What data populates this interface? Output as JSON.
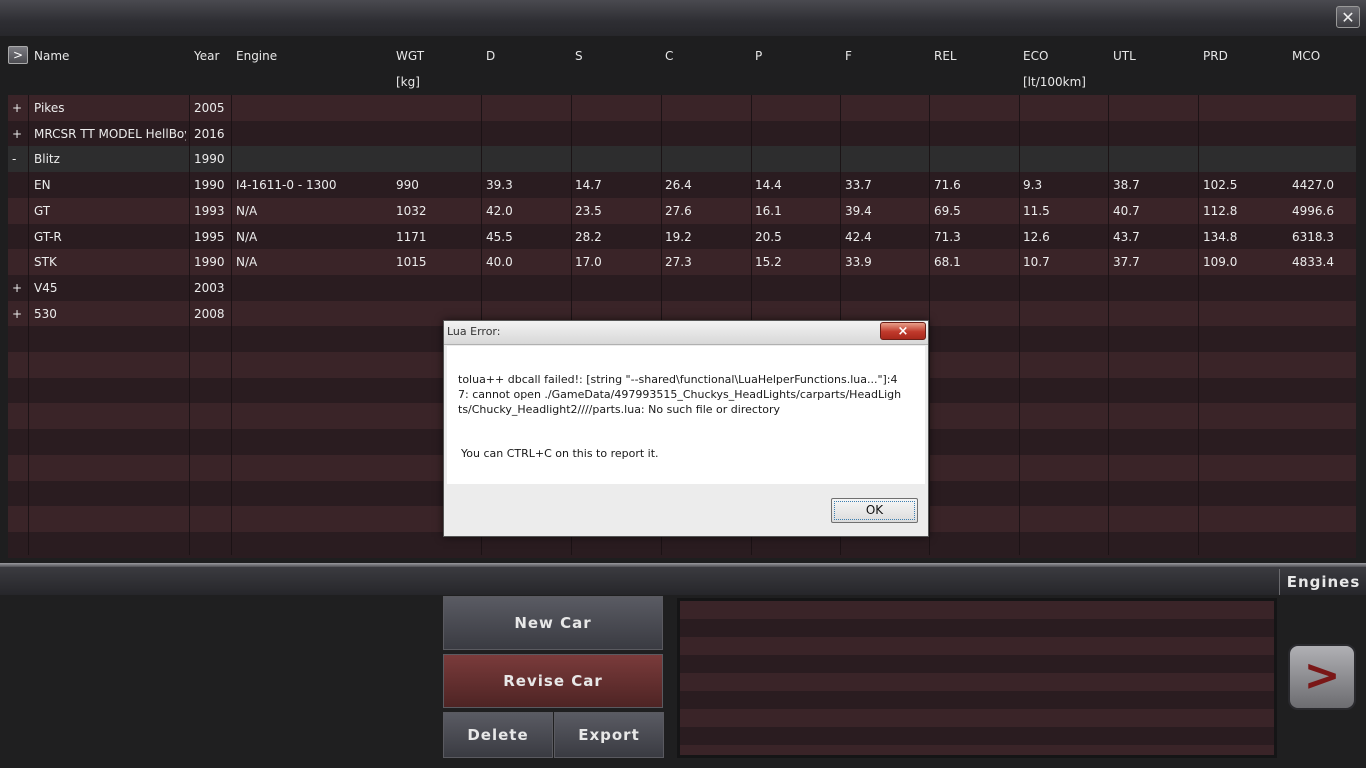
{
  "window": {
    "close_icon": "close-icon"
  },
  "table": {
    "expand_label": ">",
    "headers": [
      "Name",
      "Year",
      "Engine",
      "WGT",
      "D",
      "S",
      "C",
      "P",
      "F",
      "REL",
      "ECO",
      "UTL",
      "PRD",
      "MCO"
    ],
    "units": {
      "wgt": "[kg]",
      "eco": "[lt/100km]"
    },
    "rows": [
      {
        "toggle": "+",
        "name": "Pikes",
        "year": "2005",
        "engine": "",
        "wgt": "",
        "d": "",
        "s": "",
        "c": "",
        "p": "",
        "f": "",
        "rel": "",
        "eco": "",
        "utl": "",
        "prd": "",
        "mco": ""
      },
      {
        "toggle": "+",
        "name": "MRCSR TT MODEL HellBoy",
        "year": "2016",
        "engine": "",
        "wgt": "",
        "d": "",
        "s": "",
        "c": "",
        "p": "",
        "f": "",
        "rel": "",
        "eco": "",
        "utl": "",
        "prd": "",
        "mco": ""
      },
      {
        "toggle": "-",
        "name": "Blitz",
        "year": "1990",
        "engine": "",
        "wgt": "",
        "d": "",
        "s": "",
        "c": "",
        "p": "",
        "f": "",
        "rel": "",
        "eco": "",
        "utl": "",
        "prd": "",
        "mco": ""
      },
      {
        "toggle": "",
        "name": "EN",
        "year": "1990",
        "engine": "I4-1611-0 - 1300",
        "wgt": "990",
        "d": "39.3",
        "s": "14.7",
        "c": "26.4",
        "p": "14.4",
        "f": "33.7",
        "rel": "71.6",
        "eco": "9.3",
        "utl": "38.7",
        "prd": "102.5",
        "mco": "4427.0"
      },
      {
        "toggle": "",
        "name": "GT",
        "year": "1993",
        "engine": "N/A",
        "wgt": "1032",
        "d": "42.0",
        "s": "23.5",
        "c": "27.6",
        "p": "16.1",
        "f": "39.4",
        "rel": "69.5",
        "eco": "11.5",
        "utl": "40.7",
        "prd": "112.8",
        "mco": "4996.6"
      },
      {
        "toggle": "",
        "name": "GT-R",
        "year": "1995",
        "engine": "N/A",
        "wgt": "1171",
        "d": "45.5",
        "s": "28.2",
        "c": "19.2",
        "p": "20.5",
        "f": "42.4",
        "rel": "71.3",
        "eco": "12.6",
        "utl": "43.7",
        "prd": "134.8",
        "mco": "6318.3"
      },
      {
        "toggle": "",
        "name": "STK",
        "year": "1990",
        "engine": "N/A",
        "wgt": "1015",
        "d": "40.0",
        "s": "17.0",
        "c": "27.3",
        "p": "15.2",
        "f": "33.9",
        "rel": "68.1",
        "eco": "10.7",
        "utl": "37.7",
        "prd": "109.0",
        "mco": "4833.4"
      },
      {
        "toggle": "+",
        "name": "V45",
        "year": "2003",
        "engine": "",
        "wgt": "",
        "d": "",
        "s": "",
        "c": "",
        "p": "",
        "f": "",
        "rel": "",
        "eco": "",
        "utl": "",
        "prd": "",
        "mco": ""
      },
      {
        "toggle": "+",
        "name": "530",
        "year": "2008",
        "engine": "",
        "wgt": "",
        "d": "",
        "s": "",
        "c": "",
        "p": "",
        "f": "",
        "rel": "",
        "eco": "",
        "utl": "",
        "prd": "",
        "mco": ""
      }
    ]
  },
  "bottom": {
    "tab_label": "Engines",
    "new_car": "New Car",
    "revise_car": "Revise Car",
    "delete": "Delete",
    "export": "Export",
    "next_label": ">"
  },
  "dialog": {
    "title": "Lua Error:",
    "close_label": "×",
    "message": "tolua++ dbcall failed!: [string \"--shared\\functional\\LuaHelperFunctions.lua...\"]:47: cannot open ./GameData/497993515_Chuckys_HeadLights/carparts/HeadLights/Chucky_Headlight2////parts.lua: No such file or directory",
    "hint": "You can CTRL+C on this to report it.",
    "ok": "OK"
  },
  "colors": {
    "row_even": "#3a2428",
    "row_odd": "#2a1c20",
    "accent_red": "#7a3b3b"
  }
}
